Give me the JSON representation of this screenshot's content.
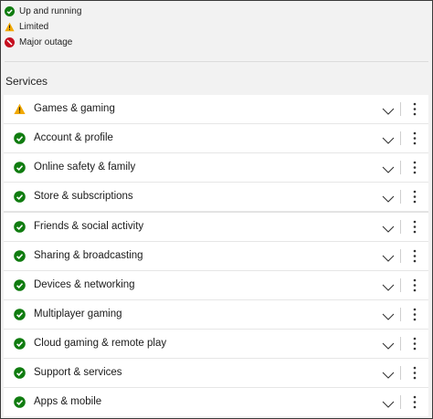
{
  "legend": {
    "items": [
      {
        "icon": "green-check-icon",
        "label": "Up and running"
      },
      {
        "icon": "warning-triangle-icon",
        "label": "Limited"
      },
      {
        "icon": "outage-icon",
        "label": "Major outage"
      }
    ]
  },
  "section": {
    "title": "Services"
  },
  "services": [
    {
      "label": "Games & gaming",
      "status": "limited"
    },
    {
      "label": "Account & profile",
      "status": "up"
    },
    {
      "label": "Online safety & family",
      "status": "up"
    },
    {
      "label": "Store & subscriptions",
      "status": "up"
    },
    {
      "label": "Friends & social activity",
      "status": "up"
    },
    {
      "label": "Sharing & broadcasting",
      "status": "up"
    },
    {
      "label": "Devices & networking",
      "status": "up"
    },
    {
      "label": "Multiplayer gaming",
      "status": "up"
    },
    {
      "label": "Cloud gaming & remote play",
      "status": "up"
    },
    {
      "label": "Support & services",
      "status": "up"
    },
    {
      "label": "Apps & mobile",
      "status": "up"
    }
  ],
  "colors": {
    "up": "#107c10",
    "limited": "#f2a900",
    "outage": "#c50f1f"
  }
}
